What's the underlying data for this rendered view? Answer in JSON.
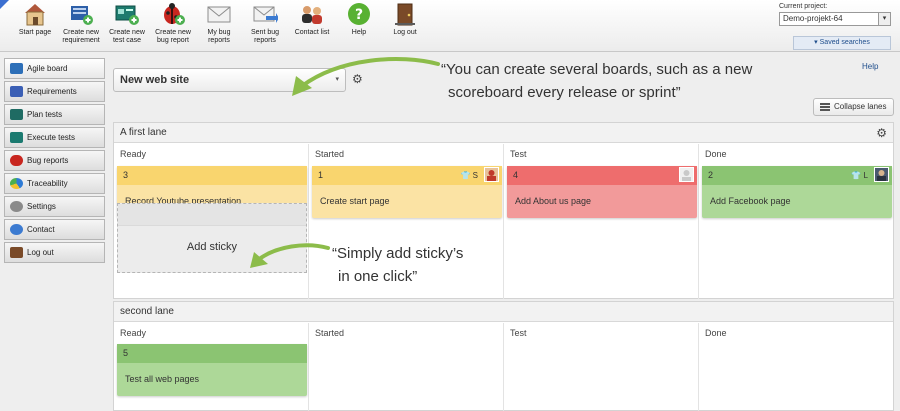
{
  "toolbar": {
    "start_page": "Start page",
    "create_requirement_1": "Create new",
    "create_requirement_2": "requirement",
    "create_test_case_1": "Create new",
    "create_test_case_2": "test case",
    "create_bug_1": "Create new",
    "create_bug_2": "bug report",
    "my_bugs_1": "My bug",
    "my_bugs_2": "reports",
    "sent_bugs_1": "Sent bug",
    "sent_bugs_2": "reports",
    "contact_list": "Contact list",
    "help": "Help",
    "log_out": "Log out"
  },
  "project": {
    "label": "Current project:",
    "value": "Demo-projekt-64",
    "saved_searches": "▾ Saved searches"
  },
  "sidebar": {
    "items": [
      {
        "label": "Agile board"
      },
      {
        "label": "Requirements"
      },
      {
        "label": "Plan tests"
      },
      {
        "label": "Execute tests"
      },
      {
        "label": "Bug reports"
      },
      {
        "label": "Traceability"
      },
      {
        "label": "Settings"
      },
      {
        "label": "Contact"
      },
      {
        "label": "Log out"
      }
    ]
  },
  "board": {
    "selected": "New web site",
    "help": "Help",
    "collapse_label": "Collapse lanes"
  },
  "callouts": {
    "boards_1": "“You can create several boards, such as a new",
    "boards_2": "scoreboard every release or sprint”",
    "sticky_1": "“Simply add sticky’s",
    "sticky_2": "in one click”"
  },
  "lanes": [
    {
      "title": "A first lane",
      "columns": [
        "Ready",
        "Started",
        "Test",
        "Done"
      ],
      "stickies": [
        {
          "id": "3",
          "text": "Record Youtube presentation",
          "meta": ""
        },
        {
          "id": "1",
          "text": "Create start page",
          "meta": "S"
        },
        {
          "id": "4",
          "text": "Add About us page",
          "meta": ""
        },
        {
          "id": "2",
          "text": "Add Facebook page",
          "meta": "L"
        }
      ],
      "add_label": "Add sticky"
    },
    {
      "title": "second lane",
      "columns": [
        "Ready",
        "Started",
        "Test",
        "Done"
      ],
      "stickies": [
        {
          "id": "5",
          "text": "Test all web pages",
          "meta": ""
        }
      ]
    }
  ],
  "colors": {
    "yellow_top": "#f9d56e",
    "yellow_body": "#fbe3a4",
    "red_top": "#ee6d6d",
    "red_body": "#f29a9a",
    "green_top": "#8bc472",
    "green_body": "#add898",
    "callout_arrow": "#8cbc4a"
  },
  "icons": {
    "start": "house-icon",
    "requirement": "requirement-add-icon",
    "test_case": "test-case-add-icon",
    "bug": "ladybug-icon",
    "my_bugs": "envelope-icon",
    "sent_bugs": "envelope-send-icon",
    "contacts": "people-icon",
    "help": "help-icon",
    "logout": "door-icon"
  }
}
